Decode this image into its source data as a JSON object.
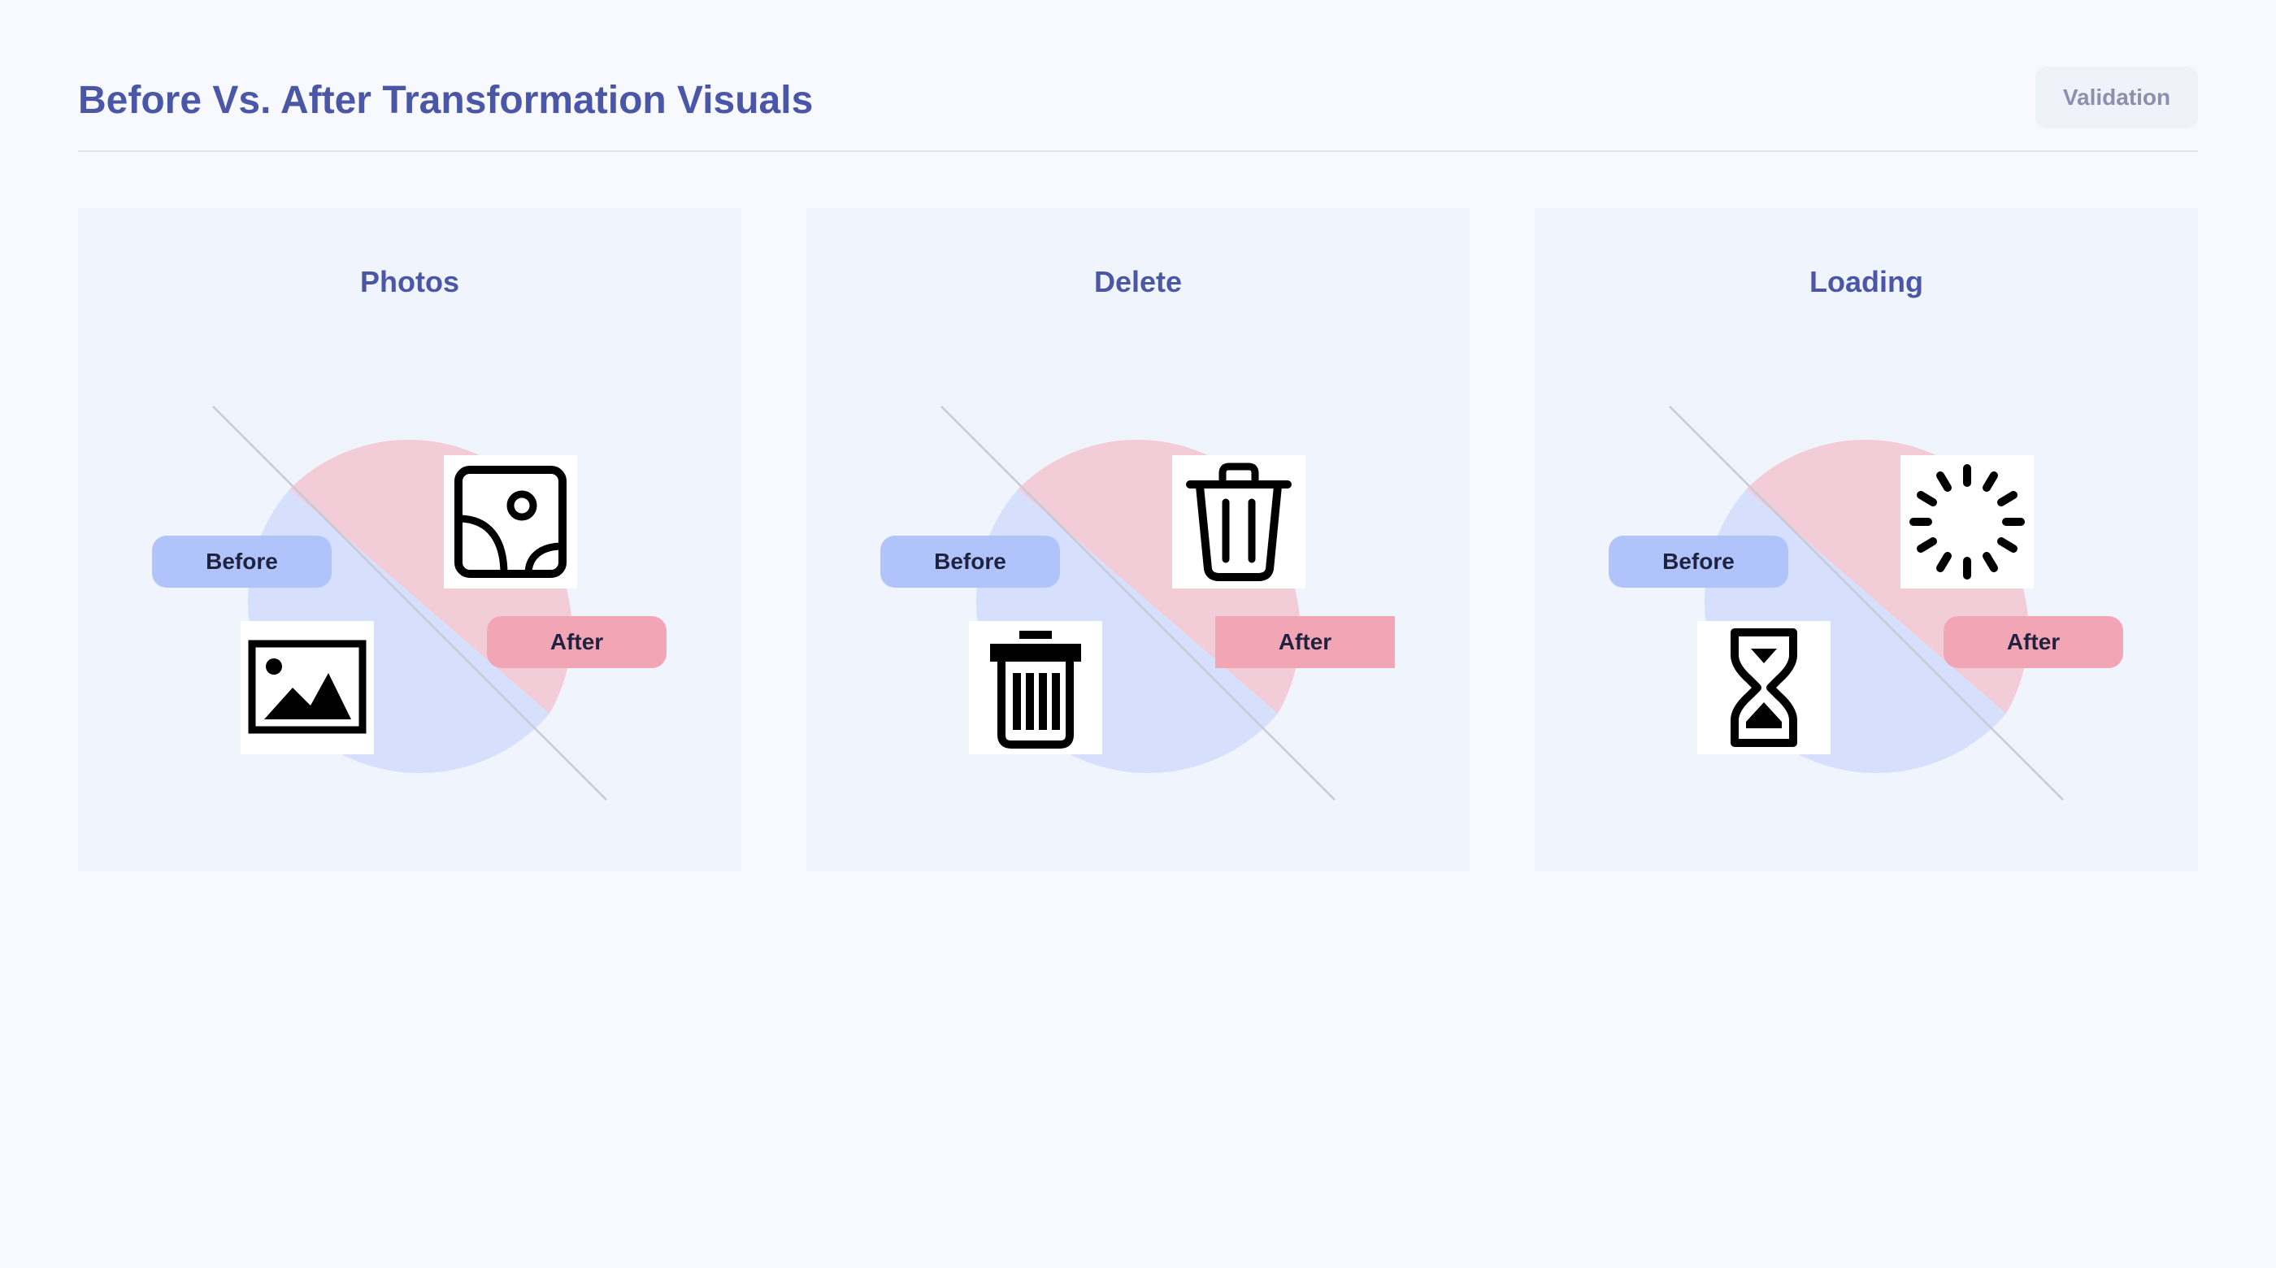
{
  "header": {
    "title": "Before Vs. After Transformation Visuals",
    "validation_label": "Validation"
  },
  "colors": {
    "before_tint": "#d6e0fc",
    "after_tint": "#f2cdd8",
    "before_pill": "#b0c4fb",
    "after_pill": "#f2a5b4",
    "title": "#4a56a6"
  },
  "cards": [
    {
      "title": "Photos",
      "before_label": "Before",
      "after_label": "After",
      "before_icon": "image-icon",
      "after_icon": "photo-icon"
    },
    {
      "title": "Delete",
      "before_label": "Before",
      "after_label": "After",
      "before_icon": "trash-filled-icon",
      "after_icon": "trash-outline-icon"
    },
    {
      "title": "Loading",
      "before_label": "Before",
      "after_label": "After",
      "before_icon": "hourglass-icon",
      "after_icon": "spinner-icon"
    }
  ]
}
